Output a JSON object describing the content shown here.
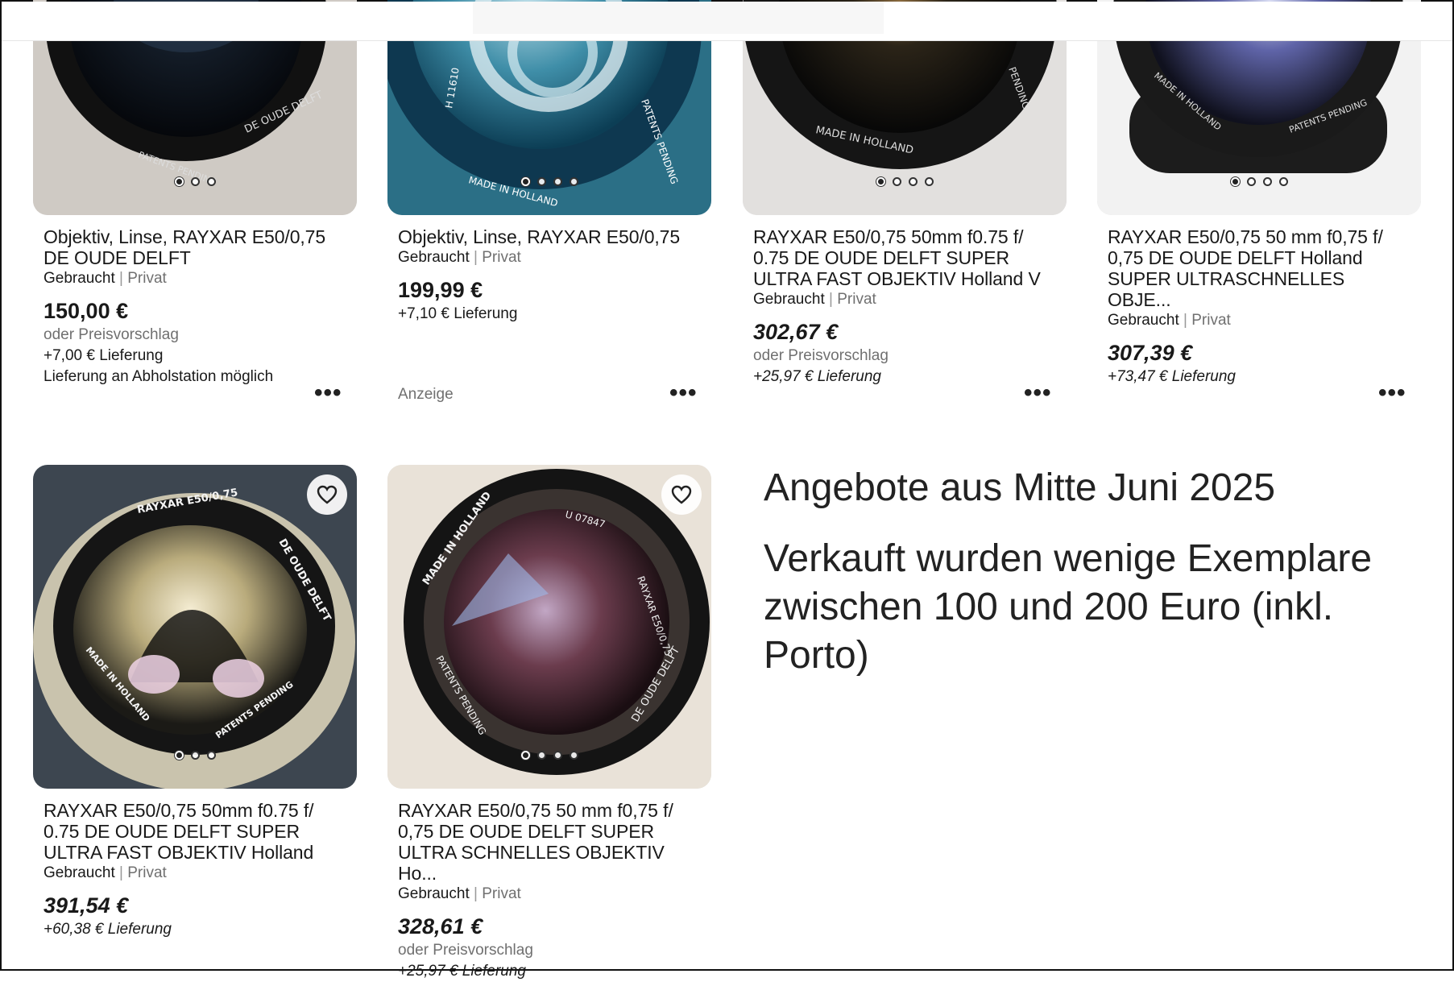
{
  "header": {},
  "listings": [
    {
      "title": "Objektiv, Linse, RAYXAR  E50/0,75 DE OUDE DELFT",
      "condition": "Gebraucht",
      "seller_type": "Privat",
      "price": "150,00 €",
      "offer": "oder Preisvorschlag",
      "shipping": "+7,00 € Lieferung",
      "pickup": "Lieferung an Abholstation möglich",
      "more": "•••"
    },
    {
      "title": "Objektiv, Linse, RAYXAR  E50/0,75",
      "condition": "Gebraucht",
      "seller_type": "Privat",
      "price": "199,99 €",
      "shipping": "+7,10 € Lieferung",
      "ad_label": "Anzeige",
      "more": "•••"
    },
    {
      "title": "RAYXAR E50/0,75 50mm f0.75 f/ 0.75 DE OUDE DELFT SUPER ULTRA FAST OBJEKTIV Holland V",
      "condition": "Gebraucht",
      "seller_type": "Privat",
      "price": "302,67 €",
      "offer": "oder Preisvorschlag",
      "shipping": "+25,97 € Lieferung",
      "more": "•••"
    },
    {
      "title": "RAYXAR E50/0,75 50 mm f0,75 f/ 0,75 DE OUDE DELFT Holland SUPER ULTRASCHNELLES OBJE...",
      "condition": "Gebraucht",
      "seller_type": "Privat",
      "price": "307,39 €",
      "shipping": "+73,47 € Lieferung",
      "more": "•••"
    },
    {
      "title": "RAYXAR E50/0,75 50mm f0.75 f/ 0.75 DE OUDE DELFT SUPER ULTRA FAST OBJEKTIV Holland",
      "condition": "Gebraucht",
      "seller_type": "Privat",
      "price": "391,54 €",
      "shipping": "+60,38 € Lieferung"
    },
    {
      "title": "RAYXAR E50/0,75 50 mm f0,75 f/ 0,75 DE OUDE DELFT SUPER ULTRA SCHNELLES OBJEKTIV Ho...",
      "condition": "Gebraucht",
      "seller_type": "Privat",
      "price": "328,61 €",
      "offer": "oder Preisvorschlag",
      "shipping": "+25,97 € Lieferung"
    }
  ],
  "separator": "|",
  "note": {
    "line1": "Angebote aus Mitte Juni 2025",
    "line2": "Verkauft wurden wenige Exemplare zwischen 100 und 200 Euro (inkl. Porto)"
  },
  "icons": {
    "heart": "heart-icon",
    "more": "more-options-icon"
  },
  "colors": {
    "text": "#191919",
    "muted": "#707070"
  },
  "image_text": {
    "lens1": [
      "DE OUDE DELFT",
      "PATENTS PENDING"
    ],
    "lens2": [
      "H 11610",
      "PATENTS PENDING",
      "MADE IN HOLLAND"
    ],
    "lens3": [
      "MADE IN HOLLAND",
      "PENDING"
    ],
    "lens4": [
      "MADE IN HOLLAND",
      "PATENTS PENDING"
    ],
    "lens5": [
      "RAYXAR E50/0,75",
      "DE OUDE DELFT",
      "MADE IN HOLLAND",
      "PATENTS PENDING"
    ],
    "lens6": [
      "MADE IN HOLLAND",
      "U 07847",
      "RAYXAR E50/0,75",
      "DE OUDE DELFT",
      "PATENTS PENDING"
    ]
  }
}
